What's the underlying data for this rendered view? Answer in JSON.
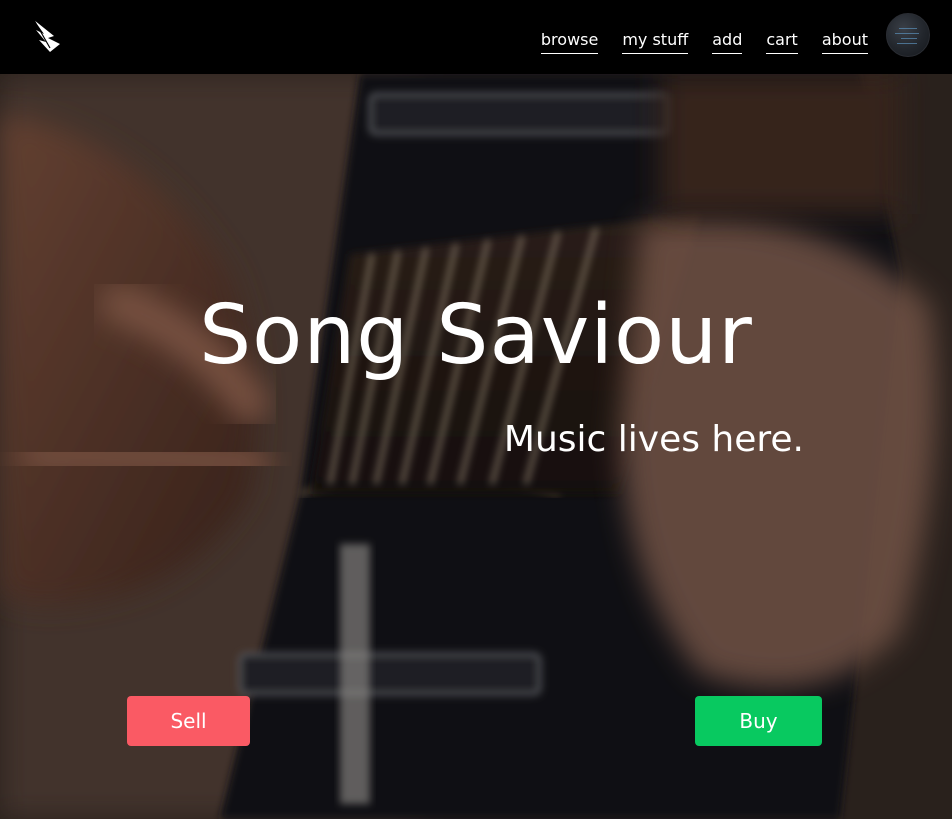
{
  "nav": {
    "links": [
      {
        "label": "browse"
      },
      {
        "label": "my stuff"
      },
      {
        "label": "add"
      },
      {
        "label": "cart"
      },
      {
        "label": "about"
      }
    ],
    "logo_icon": "winged-logo-icon",
    "avatar_icon": "user-avatar"
  },
  "hero": {
    "title": "Song Saviour",
    "tagline": "Music lives here.",
    "background": "blurred banjo being played"
  },
  "actions": {
    "sell_label": "Sell",
    "buy_label": "Buy"
  },
  "colors": {
    "navbar": "#000000",
    "sell": "#fa5a64",
    "buy": "#08c960",
    "text": "#ffffff"
  }
}
